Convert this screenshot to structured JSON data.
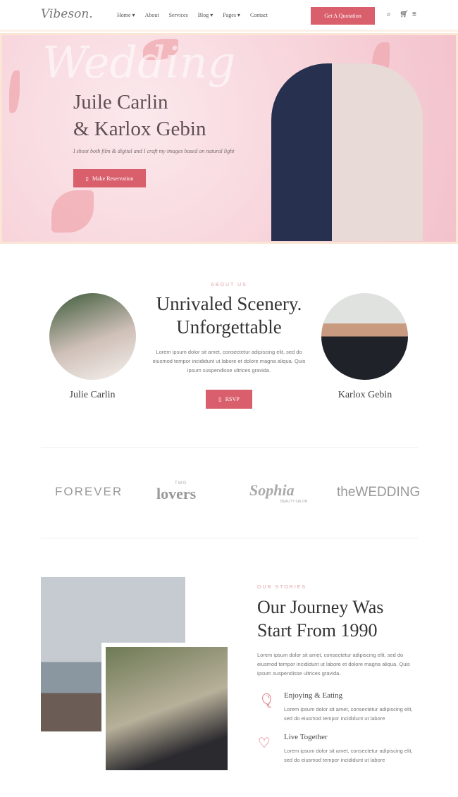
{
  "header": {
    "logo": "Vibeson.",
    "nav": [
      "Home ▾",
      "About",
      "Services",
      "Blog ▾",
      "Pages ▾",
      "Contact"
    ],
    "cta": "Get A Quotation"
  },
  "hero": {
    "script": "Wedding",
    "title_line1": "Juile Carlin",
    "title_line2": "& Karlox Gebin",
    "subtitle": "I shoot both film & digital and I craft my images based on natural light",
    "button": "Make Reservation"
  },
  "about": {
    "eyebrow": "ABOUT US",
    "title_line1": "Unrivaled Scenery.",
    "title_line2": "Unforgettable",
    "text": "Lorem ipsum dolor sit amet, consectetur adipiscing elit, sed do eiusmod tempor incididunt ut labore et dolore magna aliqua. Quis ipsum suspendisse ultrices gravida.",
    "button": "RSVP",
    "bride": "Julie Carlin",
    "groom": "Karlox Gebin"
  },
  "brands": [
    "FOREVER",
    "TWO",
    "lovers",
    "Sophia",
    "BEAUTY SALON",
    "theWEDDING"
  ],
  "stories": {
    "eyebrow": "OUR STORIES",
    "title_line1": "Our Journey Was",
    "title_line2": "Start From 1990",
    "text": "Lorem ipsum dolor sit amet, consectetur adipiscing elit, sed do eiusmod tempor incididunt ut labore et dolore magna aliqua. Quis ipsum suspendisse ultrices gravida.",
    "features": [
      {
        "title": "Enjoying & Eating",
        "text": "Lorem ipsum dolor sit amet, consectetur adipiscing elit, sed do eiusmod tempor incididunt ut labore"
      },
      {
        "title": "Live Together",
        "text": "Lorem ipsum dolor sit amet, consectetur adipiscing elit, sed do eiusmod tempor incididunt ut labore"
      }
    ]
  },
  "colors": {
    "accent": "#d95f6c",
    "hero_bg": "#f6cdd5"
  }
}
